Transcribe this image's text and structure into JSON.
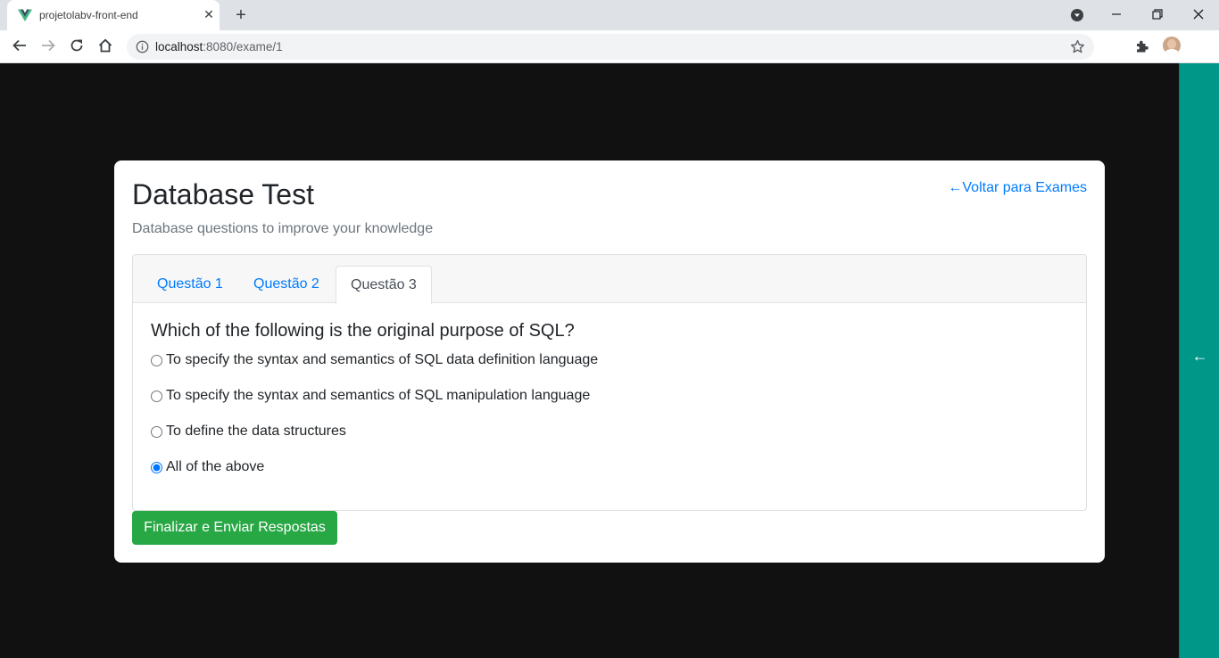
{
  "browser": {
    "tab_title": "projetolabv-front-end",
    "url_host": "localhost",
    "url_path": ":8080/exame/1",
    "extension_label": "{≡}"
  },
  "exam": {
    "title": "Database Test",
    "subtitle": "Database questions to improve your knowledge",
    "back_link": "←Voltar para Exames",
    "tabs": [
      {
        "label": "Questão 1",
        "active": false
      },
      {
        "label": "Questão 2",
        "active": false
      },
      {
        "label": "Questão 3",
        "active": true
      }
    ],
    "question": "Which of the following is the original purpose of SQL?",
    "options": [
      {
        "label": "To specify the syntax and semantics of SQL data definition language",
        "selected": false
      },
      {
        "label": "To specify the syntax and semantics of SQL manipulation language",
        "selected": false
      },
      {
        "label": "To define the data structures",
        "selected": false
      },
      {
        "label": "All of the above",
        "selected": true
      }
    ],
    "submit_label": "Finalizar e Enviar Respostas"
  },
  "side_panel": {
    "arrow": "←",
    "color": "#009688"
  },
  "colors": {
    "link": "#007bff",
    "success": "#28a745",
    "page_bg": "#111111"
  }
}
